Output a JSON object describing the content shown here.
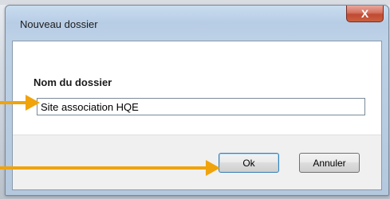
{
  "window": {
    "title": "Nouveau dossier",
    "close_symbol": "X"
  },
  "form": {
    "label": "Nom du dossier",
    "folder_name_value": "Site association HQE"
  },
  "buttons": {
    "ok_label": "Ok",
    "cancel_label": "Annuler"
  },
  "annotations": {
    "arrow_color": "#f0a30a",
    "icons": [
      "arrow-right-icon",
      "arrow-right-icon"
    ]
  }
}
